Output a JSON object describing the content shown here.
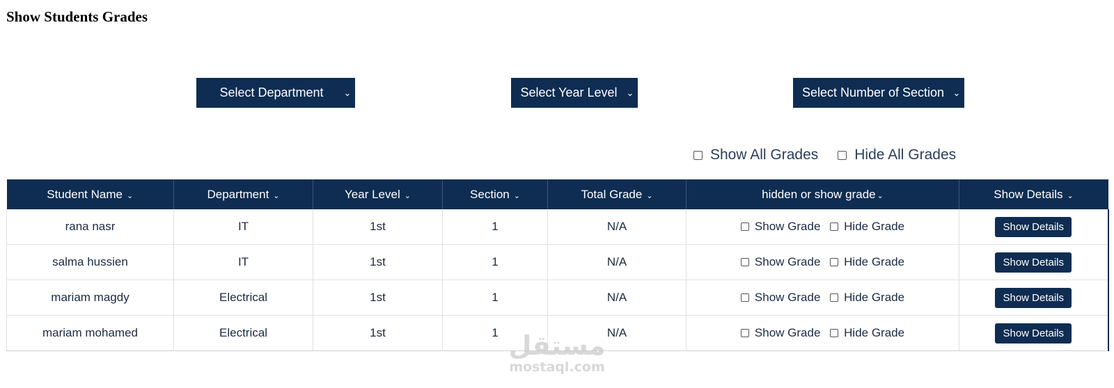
{
  "page": {
    "title": "Show Students Grades"
  },
  "filters": {
    "department": "Select Department",
    "year_level": "Select Year Level",
    "section": "Select Number of Section",
    "chevron_icon": "chevron-down-icon"
  },
  "global_toggles": {
    "show_all": "Show All Grades",
    "hide_all": "Hide All Grades"
  },
  "table": {
    "headers": {
      "student_name": "Student Name",
      "department": "Department",
      "year_level": "Year Level",
      "section": "Section",
      "total_grade": "Total Grade",
      "visibility": "hidden or show grade",
      "details": "Show Details"
    },
    "rows": [
      {
        "name": "rana nasr",
        "department": "IT",
        "year_level": "1st",
        "section": "1",
        "total_grade": "N/A",
        "show_label": "Show Grade",
        "hide_label": "Hide Grade",
        "details_label": "Show Details"
      },
      {
        "name": "salma hussien",
        "department": "IT",
        "year_level": "1st",
        "section": "1",
        "total_grade": "N/A",
        "show_label": "Show Grade",
        "hide_label": "Hide Grade",
        "details_label": "Show Details"
      },
      {
        "name": "mariam magdy",
        "department": "Electrical",
        "year_level": "1st",
        "section": "1",
        "total_grade": "N/A",
        "show_label": "Show Grade",
        "hide_label": "Hide Grade",
        "details_label": "Show Details"
      },
      {
        "name": "mariam mohamed",
        "department": "Electrical",
        "year_level": "1st",
        "section": "1",
        "total_grade": "N/A",
        "show_label": "Show Grade",
        "hide_label": "Hide Grade",
        "details_label": "Show Details"
      }
    ]
  },
  "watermark": {
    "arabic": "مستقل",
    "latin": "mostaql.com"
  },
  "colors": {
    "primary": "#0f2d52",
    "text": "#1c2b42",
    "border": "#e0e0e0"
  }
}
